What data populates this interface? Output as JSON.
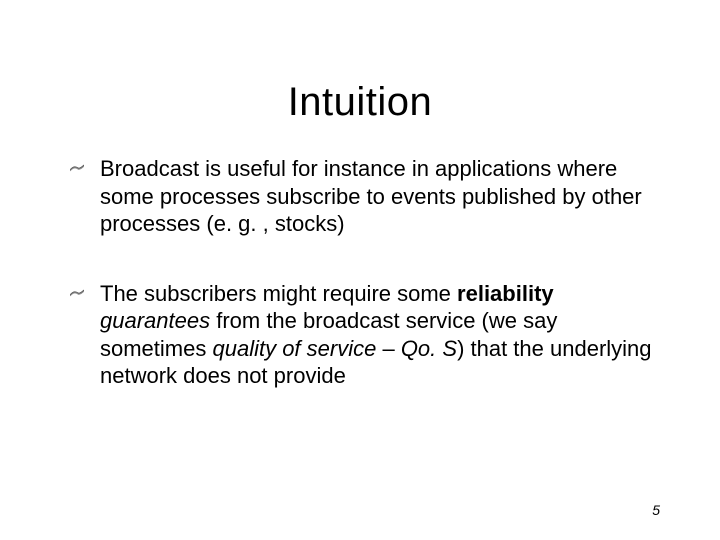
{
  "title": "Intuition",
  "bullets": [
    {
      "text": "Broadcast is useful for instance in applications where some processes subscribe to events published by other processes (e. g. , stocks)"
    },
    {
      "pre": "The subscribers might require some ",
      "bold1": "reliability",
      "gap": "  ",
      "ital1": "guarantees",
      "mid1": " from the broadcast service (we say sometimes ",
      "ital2": "quality of service",
      "mid2": " – ",
      "ital3": "Qo. S",
      "post": ") that the underlying network does not provide"
    }
  ],
  "page_number": "5"
}
